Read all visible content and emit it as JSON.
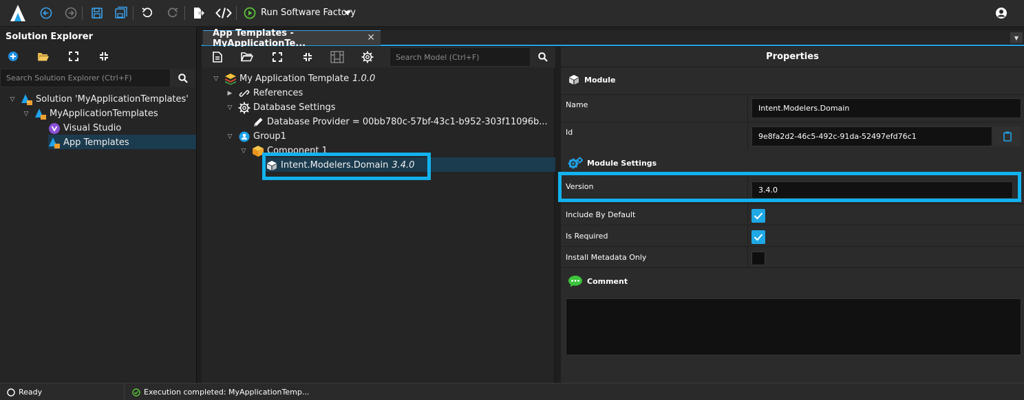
{
  "toolbar": {
    "run_label": "Run Software Factory",
    "icons": [
      "app-logo-icon",
      "back-icon",
      "forward-icon",
      "save-icon",
      "save-all-icon",
      "undo-icon",
      "redo-icon",
      "export-icon",
      "code-icon",
      "play-icon",
      "dropdown-icon",
      "account-icon"
    ]
  },
  "solution_explorer": {
    "title": "Solution Explorer",
    "search_placeholder": "Search Solution Explorer (Ctrl+F)",
    "tree": [
      {
        "label": "Solution 'MyApplicationTemplates'"
      },
      {
        "label": "MyApplicationTemplates"
      },
      {
        "label": "Visual Studio"
      },
      {
        "label": "App Templates",
        "selected": true
      }
    ]
  },
  "editor": {
    "tab_label": "App Templates - MyApplicationTe...",
    "tab_close": "✕",
    "search_placeholder": "Search Model (Ctrl+F)",
    "tree": {
      "root_label": "My Application Template",
      "root_version": "1.0.0",
      "references": "References",
      "db_settings": "Database Settings",
      "db_provider": "Database Provider = 00bb780c-57bf-43c1-b952-303f11096b...",
      "group": "Group1",
      "component": "Component 1",
      "module_label": "Intent.Modelers.Domain",
      "module_version": "3.4.0"
    }
  },
  "properties": {
    "title": "Properties",
    "module_section": "Module",
    "name_label": "Name",
    "name_value": "Intent.Modelers.Domain",
    "id_label": "Id",
    "id_value": "9e8fa2d2-46c5-492c-91da-52497efd76c1",
    "settings_section": "Module Settings",
    "version_label": "Version",
    "version_value": "3.4.0",
    "include_label": "Include By Default",
    "include_checked": true,
    "required_label": "Is Required",
    "required_checked": true,
    "metadata_label": "Install Metadata Only",
    "metadata_checked": false,
    "comment_section": "Comment",
    "comment_value": ""
  },
  "status": {
    "ready": "Ready",
    "execution": "Execution completed: MyApplicationTemp..."
  },
  "colors": {
    "accent": "#1fa3ea",
    "highlight": "#12b2ee",
    "run_green": "#5bc236"
  }
}
